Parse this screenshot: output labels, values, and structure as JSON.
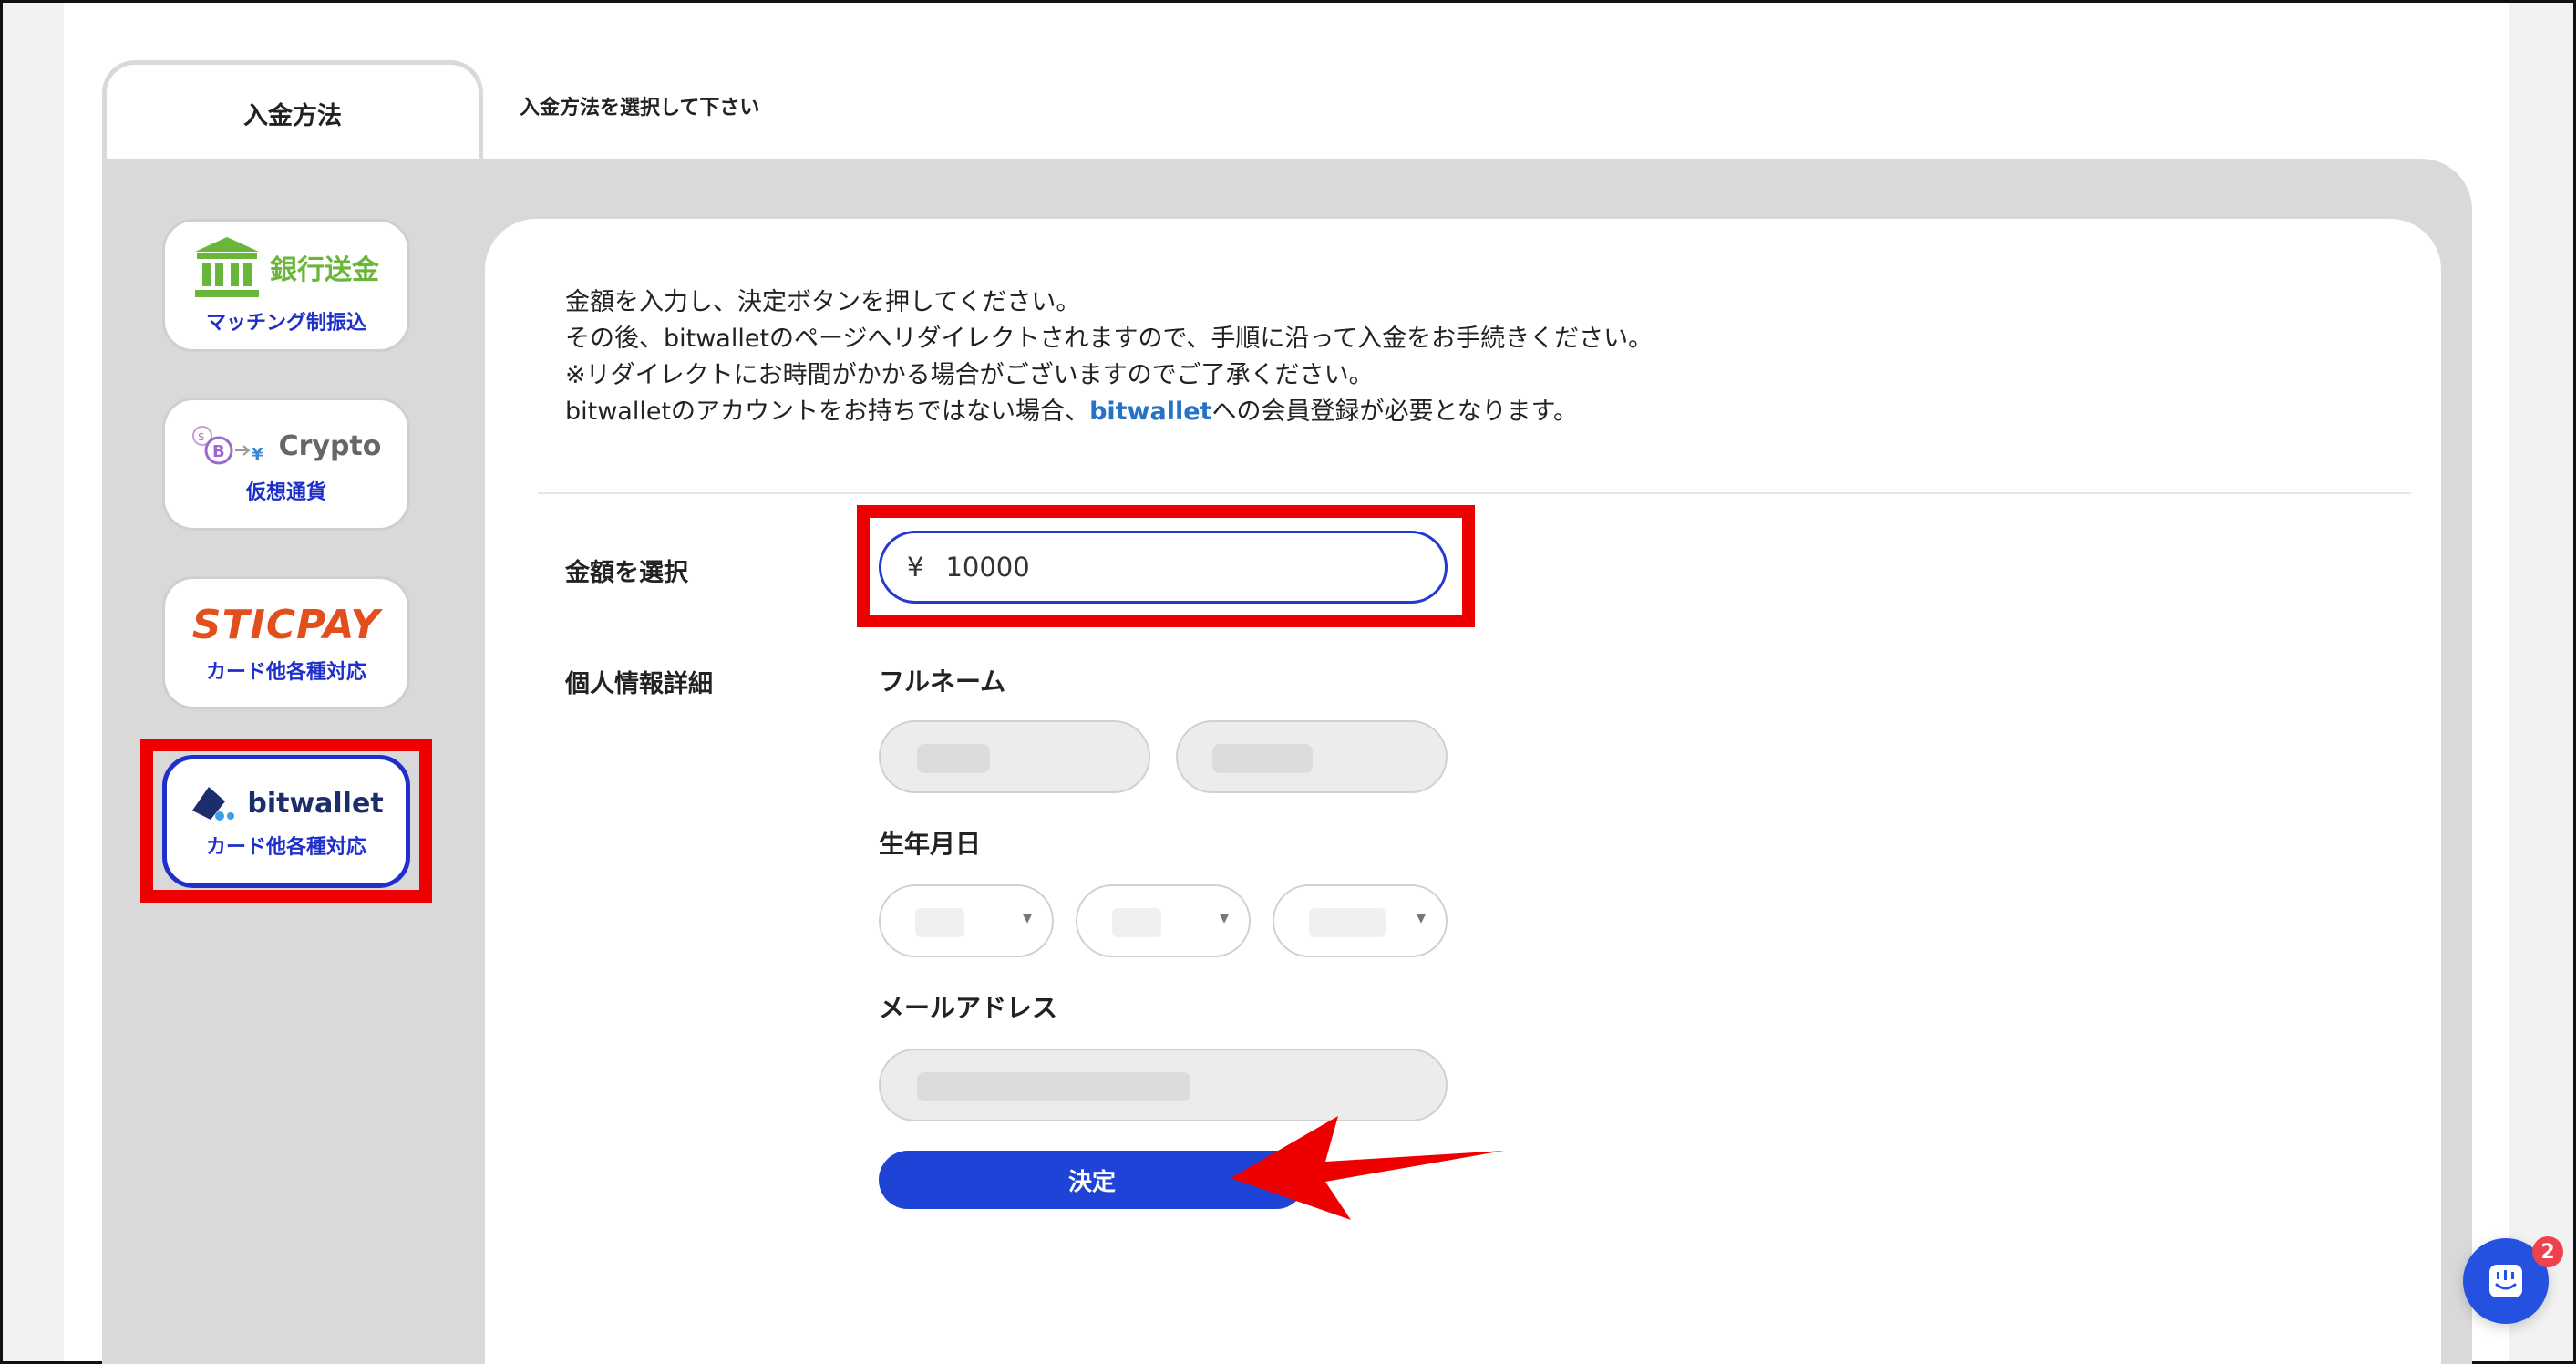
{
  "tab": {
    "label": "入金方法",
    "hint": "入金方法を選択して下さい"
  },
  "methods": [
    {
      "logo": "銀行送金",
      "sub": "マッチング制振込",
      "icon": "bank-icon",
      "color": "#6ab63a"
    },
    {
      "logo": "Crypto",
      "sub": "仮想通貨",
      "icon": "crypto-icon",
      "color": "#666666"
    },
    {
      "logo": "STICPAY",
      "sub": "カード他各種対応",
      "icon": "sticpay-logo",
      "color": "#e24f1c"
    },
    {
      "logo": "bitwallet",
      "sub": "カード他各種対応",
      "icon": "bitwallet-icon",
      "color": "#1b2d6b",
      "selected": true
    }
  ],
  "intro": {
    "line1": "金額を入力し、決定ボタンを押してください。",
    "line2": "その後、bitwalletのページへリダイレクトされますので、手順に沿って入金をお手続きください。",
    "line3": "※リダイレクトにお時間がかかる場合がございますのでご了承ください。",
    "line4_pre": "bitwalletのアカウントをお持ちではない場合、",
    "line4_link": "bitwallet",
    "line4_post": "への会員登録が必要となります。"
  },
  "form": {
    "amount_label": "金額を選択",
    "currency": "¥",
    "amount_value": "10000",
    "personal_label": "個人情報詳細",
    "fullname_label": "フルネーム",
    "birthdate_label": "生年月日",
    "email_label": "メールアドレス",
    "submit_label": "決定"
  },
  "chat": {
    "badge_count": "2"
  },
  "colors": {
    "accent": "#1f43d6",
    "highlight": "#ee0000",
    "panel": "#d9d9d9",
    "link": "#2473c6"
  }
}
